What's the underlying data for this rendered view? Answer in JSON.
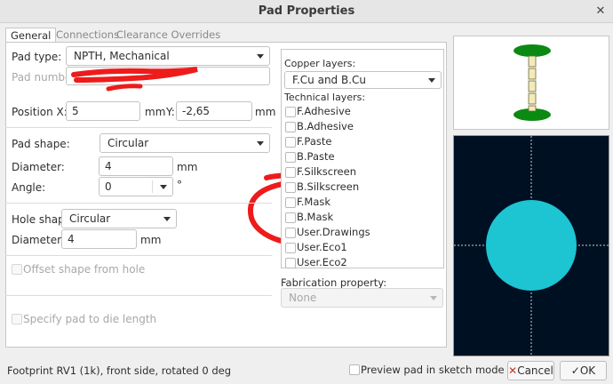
{
  "window": {
    "title": "Pad Properties"
  },
  "tabs": [
    {
      "label": "General"
    },
    {
      "label": "Connections"
    },
    {
      "label": "Clearance Overrides"
    }
  ],
  "general": {
    "pad_type_label": "Pad type:",
    "pad_type_value": "NPTH, Mechanical",
    "pad_number_label": "Pad number:",
    "pad_number_value": "",
    "position_x_label": "Position X:",
    "position_x_value": "5",
    "position_x_unit": "mm",
    "position_y_label": "Y:",
    "position_y_value": "-2,65",
    "position_y_unit": "mm",
    "pad_shape_label": "Pad shape:",
    "pad_shape_value": "Circular",
    "diameter_label": "Diameter:",
    "diameter_value": "4",
    "diameter_unit": "mm",
    "angle_label": "Angle:",
    "angle_value": "0",
    "angle_unit": "°",
    "hole_shape_label": "Hole shape:",
    "hole_shape_value": "Circular",
    "hole_diameter_label": "Diameter:",
    "hole_diameter_value": "4",
    "hole_diameter_unit": "mm",
    "offset_shape_label": "Offset shape from hole",
    "die_length_label": "Specify pad to die length"
  },
  "layers": {
    "copper_label": "Copper layers:",
    "copper_value": "F.Cu and B.Cu",
    "technical_label": "Technical layers:",
    "technical": [
      {
        "name": "F.Adhesive"
      },
      {
        "name": "B.Adhesive"
      },
      {
        "name": "F.Paste"
      },
      {
        "name": "B.Paste"
      },
      {
        "name": "F.Silkscreen"
      },
      {
        "name": "B.Silkscreen"
      },
      {
        "name": "F.Mask"
      },
      {
        "name": "B.Mask"
      },
      {
        "name": "User.Drawings"
      },
      {
        "name": "User.Eco1"
      },
      {
        "name": "User.Eco2"
      }
    ]
  },
  "fabrication": {
    "label": "Fabrication property:",
    "value": "None"
  },
  "footer": {
    "status": "Footprint RV1 (1k), front side, rotated 0 deg",
    "sketch_label": "Preview pad in sketch mode",
    "cancel_label": "Cancel",
    "ok_label": "OK",
    "cancel_icon": "cancel-x-icon",
    "ok_icon": "checkmark-icon"
  },
  "colors": {
    "preview_background": "#001023",
    "pad_fill": "#1dc4d2",
    "crosshair": "#cfcfcf",
    "stack_pad": "#0b8a12",
    "stack_layer": "#f2eab8",
    "annotation_red": "#ee1b1b"
  }
}
